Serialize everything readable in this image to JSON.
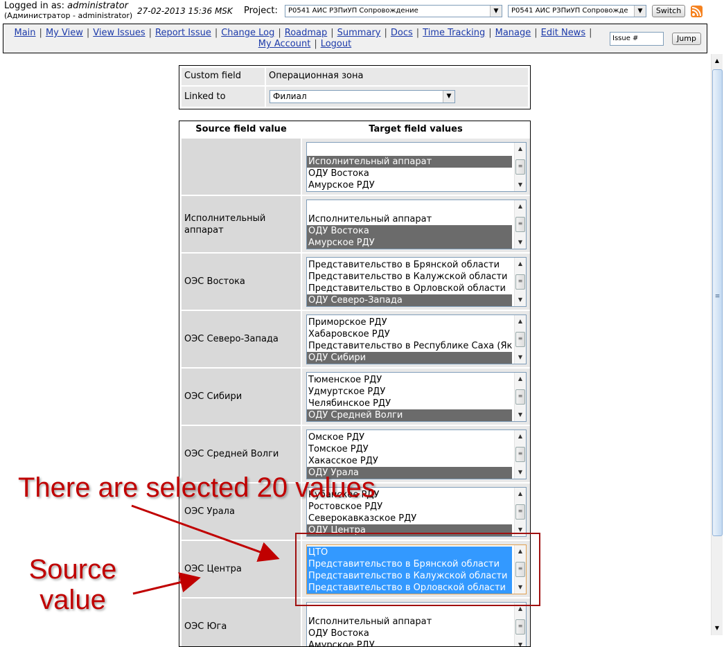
{
  "header": {
    "login_prefix": "Logged in as:",
    "login_user": "administrator",
    "login_sub": "(Администратор - administrator)",
    "clock": "27-02-2013 15:36 MSK",
    "project_label": "Project:",
    "project_select_1": "P0541 АИС РЗПиУП Сопровождение",
    "project_select_2": "P0541 АИС РЗПиУП Сопровожде",
    "switch_label": "Switch",
    "rss_icon": "rss-icon"
  },
  "menu": {
    "items": [
      "Main",
      "My View",
      "View Issues",
      "Report Issue",
      "Change Log",
      "Roadmap",
      "Summary",
      "Docs",
      "Time Tracking",
      "Manage",
      "Edit News",
      "My Account",
      "Logout"
    ],
    "issue_placeholder": "Issue #",
    "jump_label": "Jump"
  },
  "field_table": {
    "custom_field_label": "Custom field",
    "custom_field_value": "Операционная зона",
    "linked_to_label": "Linked to",
    "linked_to_value": "Филиал"
  },
  "mapping": {
    "source_header": "Source field value",
    "target_header": "Target field values",
    "rows": [
      {
        "source": "",
        "options": [
          "",
          "Исполнительный аппарат",
          "ОДУ Востока",
          "Амурское РДУ"
        ],
        "selected": [
          1
        ]
      },
      {
        "source": "Исполнительный аппарат",
        "options": [
          "",
          "Исполнительный аппарат",
          "ОДУ Востока",
          "Амурское РДУ"
        ],
        "selected": [
          2,
          3
        ]
      },
      {
        "source": "ОЭС Востока",
        "options": [
          "Представительство в Брянской области",
          "Представительство в Калужской области",
          "Представительство в Орловской области",
          "ОДУ Северо-Запада"
        ],
        "selected": [
          3
        ]
      },
      {
        "source": "ОЭС Северо-Запада",
        "options": [
          "Приморское РДУ",
          "Хабаровское РДУ",
          "Представительство в Республике Саха (Якутия)",
          "ОДУ Сибири"
        ],
        "selected": [
          3
        ]
      },
      {
        "source": "ОЭС Сибири",
        "options": [
          "Тюменское РДУ",
          "Удмуртское РДУ",
          "Челябинское РДУ",
          "ОДУ Средней Волги"
        ],
        "selected": [
          3
        ]
      },
      {
        "source": "ОЭС Средней Волги",
        "options": [
          "Омское РДУ",
          "Томское РДУ",
          "Хакасское РДУ",
          "ОДУ Урала"
        ],
        "selected": [
          3
        ]
      },
      {
        "source": "ОЭС Урала",
        "options": [
          "Кубанское РДУ",
          "Ростовское РДУ",
          "Северокавказское РДУ",
          "ОДУ Центра"
        ],
        "selected": [
          3
        ]
      },
      {
        "source": "ОЭС Центра",
        "options": [
          "ЦТО",
          "Представительство в Брянской области",
          "Представительство в Калужской области",
          "Представительство в Орловской области"
        ],
        "selected": [
          0,
          1,
          2,
          3
        ],
        "focused": true
      },
      {
        "source": "ОЭС Юга",
        "options": [
          "",
          "Исполнительный аппарат",
          "ОДУ Востока",
          "Амурское РДУ"
        ],
        "selected": []
      }
    ]
  },
  "annotations": {
    "selected_note": "There are selected 20 values",
    "source_note": "Source value",
    "color": "#c00000"
  },
  "colors": {
    "selection_gray": "#6b6b6b",
    "selection_blue": "#3399ff",
    "link": "#1c3aa9"
  }
}
